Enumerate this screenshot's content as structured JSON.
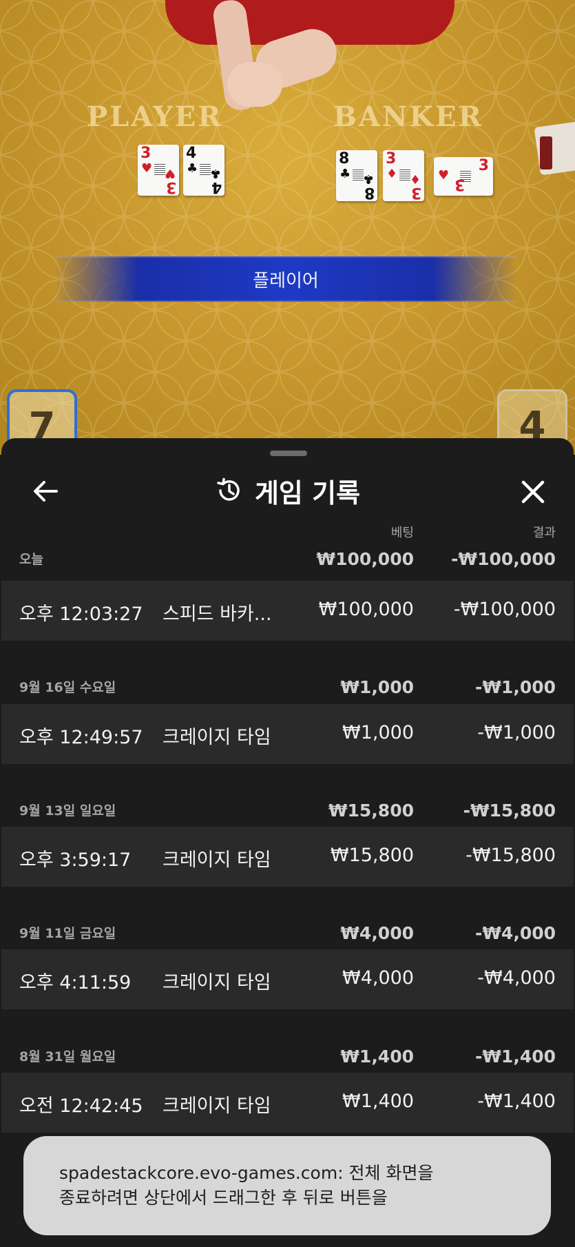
{
  "table": {
    "player_label": "PLAYER",
    "banker_label": "BANKER",
    "result_text": "플레이어",
    "player_score": "7",
    "banker_score": "4",
    "player_cards": [
      {
        "rank": "3",
        "suit": "♥",
        "color": "red"
      },
      {
        "rank": "4",
        "suit": "♣",
        "color": "black"
      }
    ],
    "banker_cards": [
      {
        "rank": "8",
        "suit": "♣",
        "color": "black"
      },
      {
        "rank": "3",
        "suit": "♦",
        "color": "red"
      },
      {
        "rank": "3",
        "suit": "♥",
        "color": "red"
      }
    ]
  },
  "sheet": {
    "title": "게임 기록",
    "icons": {
      "back": "arrow-left-icon",
      "history": "history-icon",
      "close": "close-icon"
    },
    "col_bet": "베팅",
    "col_result": "결과",
    "groups": [
      {
        "date": "오늘",
        "bet": "₩100,000",
        "result": "-₩100,000",
        "rows": [
          {
            "time": "오후 12:03:27",
            "game": "스피드 바카...",
            "bet": "₩100,000",
            "result": "-₩100,000"
          }
        ]
      },
      {
        "date": "9월 16일 수요일",
        "bet": "₩1,000",
        "result": "-₩1,000",
        "rows": [
          {
            "time": "오후 12:49:57",
            "game": "크레이지 타임",
            "bet": "₩1,000",
            "result": "-₩1,000"
          }
        ]
      },
      {
        "date": "9월 13일 일요일",
        "bet": "₩15,800",
        "result": "-₩15,800",
        "rows": [
          {
            "time": "오후 3:59:17",
            "game": "크레이지 타임",
            "bet": "₩15,800",
            "result": "-₩15,800"
          }
        ]
      },
      {
        "date": "9월 11일 금요일",
        "bet": "₩4,000",
        "result": "-₩4,000",
        "rows": [
          {
            "time": "오후 4:11:59",
            "game": "크레이지 타임",
            "bet": "₩4,000",
            "result": "-₩4,000"
          }
        ]
      },
      {
        "date": "8월 31일 월요일",
        "bet": "₩1,400",
        "result": "-₩1,400",
        "rows": [
          {
            "time": "오전 12:42:45",
            "game": "크레이지 타임",
            "bet": "₩1,400",
            "result": "-₩1,400"
          }
        ]
      }
    ]
  },
  "toast": {
    "line1": "spadestackcore.evo-games.com: 전체 화면을",
    "line2": "종료하려면 상단에서 드래그한 후 뒤로 버튼을"
  },
  "colors": {
    "sheet_bg": "#1c1c1c",
    "row_bg": "#2a2a2a",
    "banner_blue": "#1e3ac4",
    "felt": "#c9992f"
  }
}
